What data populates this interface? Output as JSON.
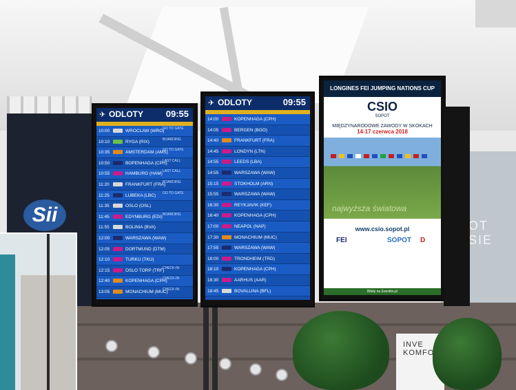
{
  "boards": [
    {
      "title": "ODLOTY",
      "time": "09:55",
      "rows": [
        {
          "time": "10:00",
          "dest": "WROCLAW (WRO)",
          "status": "GO TO GATE",
          "logo": "#d8d8d8"
        },
        {
          "time": "10:10",
          "dest": "RYGA (RIX)",
          "status": "BOARDING",
          "logo": "#6ac04a"
        },
        {
          "time": "10:35",
          "dest": "AMSTERDAM (AMS)",
          "status": "GO TO GATE",
          "logo": "#e08a20"
        },
        {
          "time": "10:50",
          "dest": "BOPENHAGA (CPH)",
          "status": "LAST CALL",
          "logo": "#1b2b6e"
        },
        {
          "time": "10:55",
          "dest": "HAMBURG (HAM)",
          "status": "LAST CALL",
          "logo": "#c91c8a"
        },
        {
          "time": "11:20",
          "dest": "FRANKFURT (FRA)",
          "status": "BOARDING",
          "logo": "#d8d8d8"
        },
        {
          "time": "11:25",
          "dest": "LUBEKA (LBC)",
          "status": "GO TO GATE",
          "logo": "#1b2b6e"
        },
        {
          "time": "11:35",
          "dest": "OSLO (OSL)",
          "status": "",
          "logo": "#d8d8d8"
        },
        {
          "time": "11:45",
          "dest": "EDYNBURG (EDI)",
          "status": "BOARDING",
          "logo": "#c91c8a"
        },
        {
          "time": "11:55",
          "dest": "BOLINIA (BVA)",
          "status": "",
          "logo": "#d8d8d8"
        },
        {
          "time": "12:00",
          "dest": "WARSZAWA (WAW)",
          "status": "",
          "logo": "#1b2b6e"
        },
        {
          "time": "12:05",
          "dest": "DORTMUND (DTM)",
          "status": "",
          "logo": "#c91c8a"
        },
        {
          "time": "12:10",
          "dest": "TURKU (TKU)",
          "status": "",
          "logo": "#c91c8a"
        },
        {
          "time": "12:15",
          "dest": "OSLO TORP (TRF)",
          "status": "CHECK-IN",
          "logo": "#c91c8a"
        },
        {
          "time": "12:40",
          "dest": "KOPENHAGA (CPH)",
          "status": "CHECK-IN",
          "logo": "#e08a20"
        },
        {
          "time": "13:05",
          "dest": "MONACHIUM (MUC)",
          "status": "CHECK-IN",
          "logo": "#e08a20"
        },
        {
          "time": "13:55",
          "dest": "AMSTERDAM (AMS)",
          "status": "",
          "logo": "#d8d8d8"
        }
      ]
    },
    {
      "title": "ODLOTY",
      "time": "09:55",
      "rows": [
        {
          "time": "14:00",
          "dest": "KOPENHAGA (CPH)",
          "status": "",
          "logo": "#c91c8a"
        },
        {
          "time": "14:05",
          "dest": "BERGEN (BGO)",
          "status": "",
          "logo": "#c91c8a"
        },
        {
          "time": "14:40",
          "dest": "FRANKFURT (FRA)",
          "status": "",
          "logo": "#e08a20"
        },
        {
          "time": "14:45",
          "dest": "LONDYN (LTN)",
          "status": "",
          "logo": "#c91c8a"
        },
        {
          "time": "14:55",
          "dest": "LEEDS (LBA)",
          "status": "",
          "logo": "#c91c8a"
        },
        {
          "time": "14:55",
          "dest": "WARSZAWA (WAW)",
          "status": "",
          "logo": "#1b2b6e"
        },
        {
          "time": "15:15",
          "dest": "STOKHOLM (ARN)",
          "status": "",
          "logo": "#c91c8a"
        },
        {
          "time": "15:55",
          "dest": "WARSZAWA (WAW)",
          "status": "",
          "logo": "#1b2b6e"
        },
        {
          "time": "16:30",
          "dest": "REYKJAVIK (KEF)",
          "status": "",
          "logo": "#c91c8a"
        },
        {
          "time": "16:40",
          "dest": "KOPENHAGA (CPH)",
          "status": "",
          "logo": "#c91c8a"
        },
        {
          "time": "17:00",
          "dest": "NEAPOL (NAP)",
          "status": "",
          "logo": "#c91c8a"
        },
        {
          "time": "17:30",
          "dest": "MONACHIUM (MUC)",
          "status": "",
          "logo": "#e08a20"
        },
        {
          "time": "17:55",
          "dest": "WARSZAWA (WAW)",
          "status": "",
          "logo": "#1b2b6e"
        },
        {
          "time": "18:00",
          "dest": "TRONDHEIM (TRD)",
          "status": "",
          "logo": "#c91c8a"
        },
        {
          "time": "18:10",
          "dest": "KOPENHAGA (CPH)",
          "status": "",
          "logo": "#1b2b6e"
        },
        {
          "time": "18:30",
          "dest": "AARHUS (AAR)",
          "status": "",
          "logo": "#c91c8a"
        },
        {
          "time": "18:45",
          "dest": "BOVALLINA (BFL)",
          "status": "",
          "logo": "#d8d8d8"
        }
      ]
    }
  ],
  "advert": {
    "top": "LONGINES  FEI JUMPING NATIONS CUP",
    "brand": "CSIO",
    "brand_sub": "SOPOT",
    "event": "MIĘDZYNARODOWE ZAWODY W SKOKACH",
    "dates": "14-17 czerwca 2018",
    "slogan": "najwyższa światowa",
    "url": "www.csio.sopot.pl",
    "sponsors": [
      "FEI",
      "SOPOT",
      "D"
    ],
    "bottom": "Bilety na Eventim.pl"
  },
  "signs": {
    "sii": "Sii",
    "right": "OT SIE",
    "store": "INVE KOMFO"
  },
  "colors": {
    "board_bg": "#1551b0",
    "board_head": "#0c2d6a",
    "accent": "#e0b020"
  }
}
